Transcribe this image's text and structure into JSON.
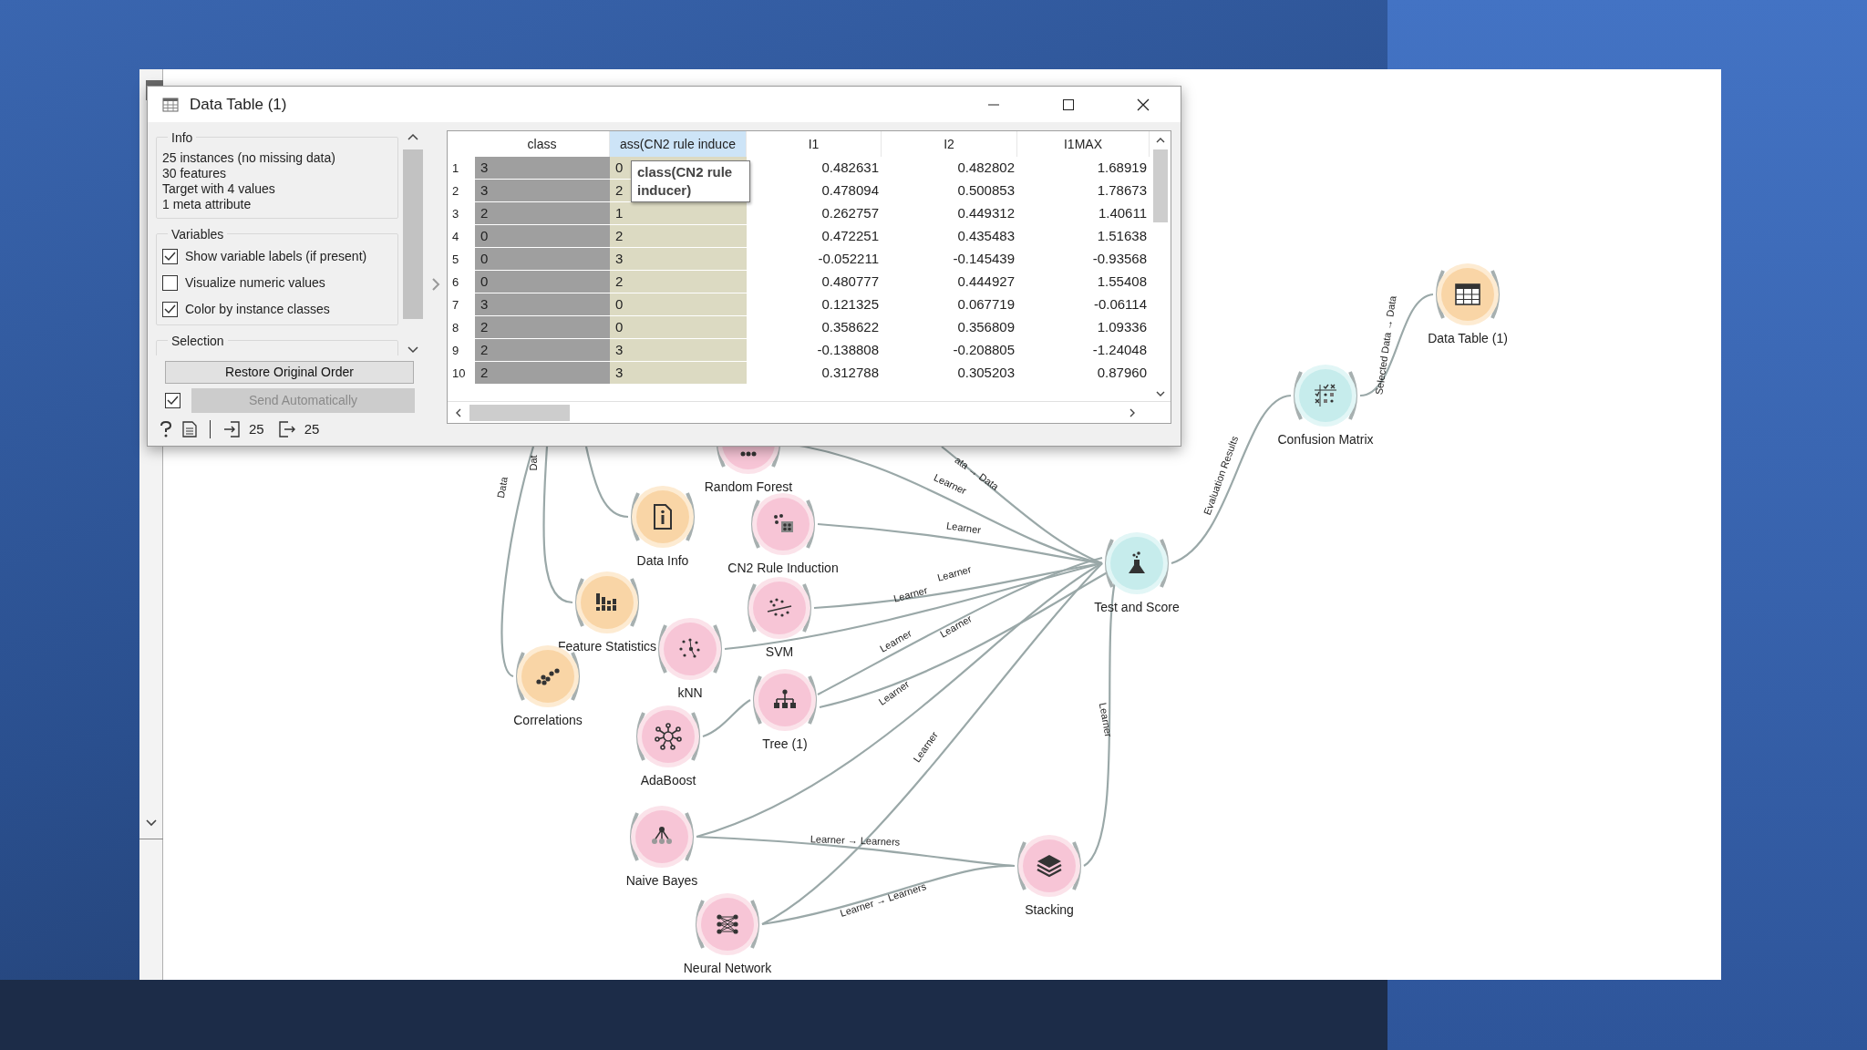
{
  "window": {
    "title": "Data Table (1)"
  },
  "info": {
    "title": "Info",
    "lines": [
      "25 instances (no missing data)",
      "30 features",
      "Target with 4 values",
      "1 meta attribute"
    ]
  },
  "variables": {
    "title": "Variables",
    "options": [
      {
        "label": "Show variable labels (if present)",
        "checked": true
      },
      {
        "label": "Visualize numeric values",
        "checked": false
      },
      {
        "label": "Color by instance classes",
        "checked": true
      }
    ]
  },
  "selection": {
    "title": "Selection"
  },
  "restore_button": {
    "label": "Restore Original Order"
  },
  "send": {
    "label": "Send Automatically",
    "checked": true,
    "disabled": true
  },
  "status_bar": {
    "input": "25",
    "output": "25"
  },
  "table": {
    "columns": [
      {
        "label": "class",
        "kind": "class",
        "selected": false
      },
      {
        "label": "ass(CN2 rule induce",
        "kind": "meta",
        "selected": true
      },
      {
        "label": "I1",
        "kind": "feature",
        "selected": false
      },
      {
        "label": "I2",
        "kind": "feature",
        "selected": false
      },
      {
        "label": "I1MAX",
        "kind": "feature",
        "selected": false
      }
    ],
    "rows": [
      {
        "number": "1",
        "cells": [
          "3",
          "0",
          "0.482631",
          "0.482802",
          "1.68919"
        ]
      },
      {
        "number": "2",
        "cells": [
          "3",
          "2",
          "0.478094",
          "0.500853",
          "1.78673"
        ]
      },
      {
        "number": "3",
        "cells": [
          "2",
          "1",
          "0.262757",
          "0.449312",
          "1.40611"
        ]
      },
      {
        "number": "4",
        "cells": [
          "0",
          "2",
          "0.472251",
          "0.435483",
          "1.51638"
        ]
      },
      {
        "number": "5",
        "cells": [
          "0",
          "3",
          "-0.052211",
          "-0.145439",
          "-0.93568"
        ]
      },
      {
        "number": "6",
        "cells": [
          "0",
          "2",
          "0.480777",
          "0.444927",
          "1.55408"
        ]
      },
      {
        "number": "7",
        "cells": [
          "3",
          "0",
          "0.121325",
          "0.067719",
          "-0.06114"
        ]
      },
      {
        "number": "8",
        "cells": [
          "2",
          "0",
          "0.358622",
          "0.356809",
          "1.09336"
        ]
      },
      {
        "number": "9",
        "cells": [
          "2",
          "3",
          "-0.138808",
          "-0.208805",
          "-1.24048"
        ]
      },
      {
        "number": "10",
        "cells": [
          "2",
          "3",
          "0.312788",
          "0.305203",
          "0.87960"
        ]
      }
    ]
  },
  "tooltip": {
    "lines": [
      "class(CN2 rule",
      "inducer)"
    ]
  },
  "canvas": {
    "nodes": [
      {
        "label": "Random Forest",
        "kind": "forest"
      },
      {
        "label": "Data Info",
        "kind": "info"
      },
      {
        "label": "CN2 Rule Induction",
        "kind": "rules"
      },
      {
        "label": "Feature Statistics",
        "kind": "statistics"
      },
      {
        "label": "SVM",
        "kind": "svm"
      },
      {
        "label": "kNN",
        "kind": "knn"
      },
      {
        "label": "Correlations",
        "kind": "correlations"
      },
      {
        "label": "Tree (1)",
        "kind": "tree"
      },
      {
        "label": "AdaBoost",
        "kind": "boost"
      },
      {
        "label": "Naive Bayes",
        "kind": "bayes"
      },
      {
        "label": "Neural Network",
        "kind": "network"
      },
      {
        "label": "Stacking",
        "kind": "stacking"
      },
      {
        "label": "Test and Score",
        "kind": "test"
      },
      {
        "label": "Confusion Matrix",
        "kind": "confusion"
      },
      {
        "label": "Data Table (1)",
        "kind": "table"
      }
    ],
    "edge_labels": [
      "Data",
      "Dat",
      "ata → Data",
      "Learner",
      "Learner",
      "Learner",
      "Learner",
      "Learner",
      "Learner",
      "Learner",
      "Learner",
      "Learner",
      "Learner → Learners",
      "Learner → Learners",
      "Evaluation Results",
      "Selected Data → Data"
    ]
  }
}
